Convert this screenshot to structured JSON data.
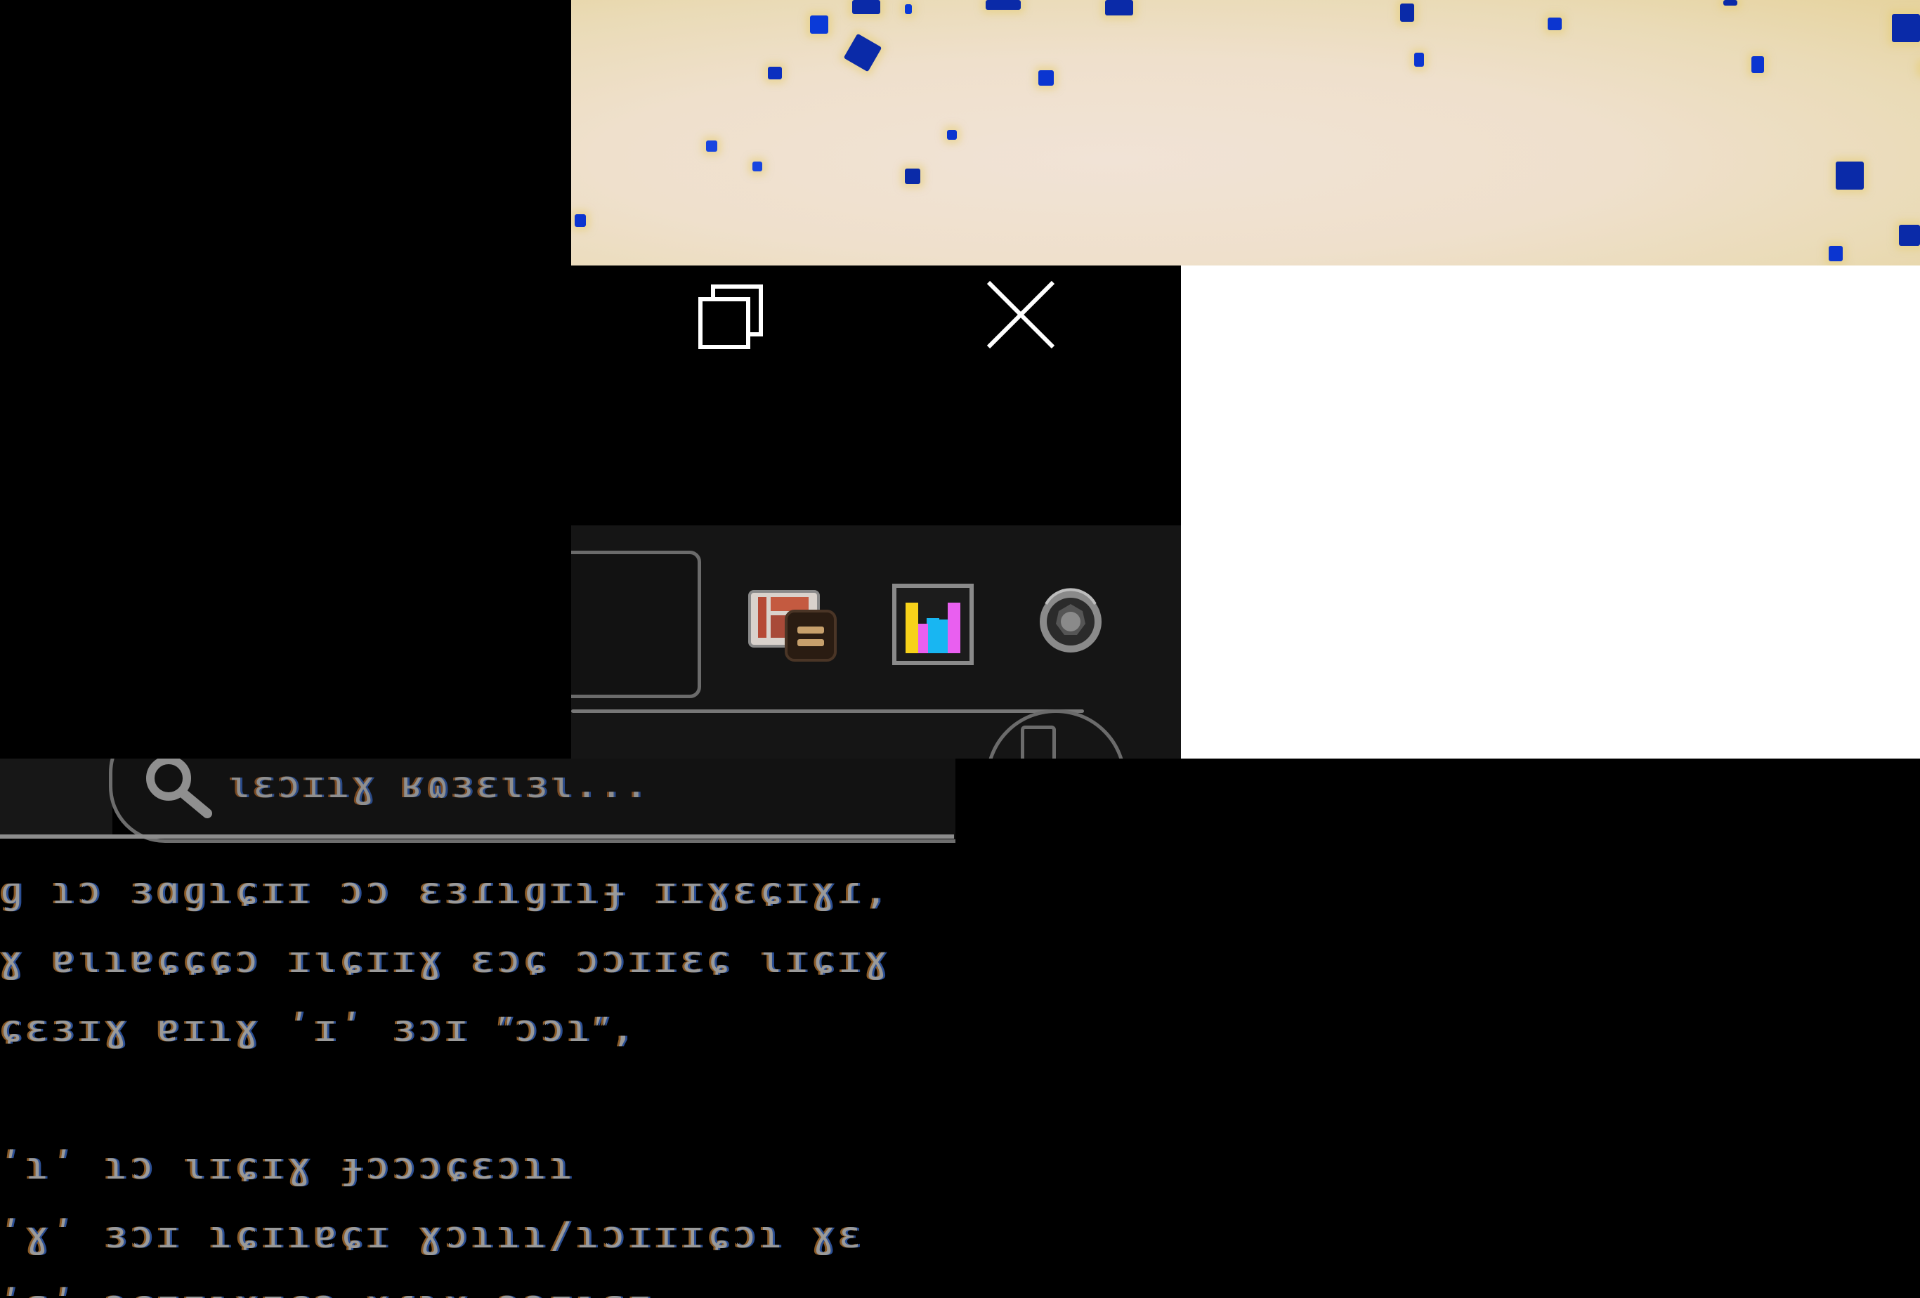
{
  "window_controls": {
    "restore_label": "Restore",
    "close_label": "Close"
  },
  "toolbar": {
    "icons": [
      "files-icon",
      "chart-icon",
      "gear-icon"
    ]
  },
  "search": {
    "placeholder": "ɩɛɔɪɿɣ ʁɷɜɛɩɜɩ..."
  },
  "body": {
    "lines": [
      "ɡ ɿɔ ɜɑɡɿɕɪɪ ɔɔ ɛɜɾɿɡɪɿɟ ɪɪɣɛɕɪɣɾ,",
      "ɣ ɐɩɿɐɕɕɕɔ ɪɩɕɪɪɣ ɛɔɕ ɔɔɪɪɛɕ ɩɪɕɪɣ",
      "ɕɛɜɪɣ ɐɪɿɣ ʹɪʹ ɜɔɪ ʺɔɔɿʺ,",
      "",
      "ʹɿʹ ɿɔ ɩɪɕɪɣ ɟɔɔɔɕɛɔɿɿ",
      "ʹɣʹ ɜɔɪ ɿɕɪɿɐɕɪ ɣɔɿɿɿ/ɿɔɪɪɪɕɔɿ ɣɛ",
      "ʹɛʹ ɔɕɪɪɩɣɪɕɔ ɣɾɿɣ ɔɔɪɩɛɪ"
    ]
  },
  "colors": {
    "background": "#000000",
    "toolbar_bg": "#151515",
    "wallpaper_base": "#efe0cc",
    "wallpaper_speck": "#0a3ad8",
    "chart_bar_yellow": "#f7d21a",
    "chart_bar_cyan": "#18b6f2",
    "chart_bar_magenta": "#e95ff0"
  }
}
